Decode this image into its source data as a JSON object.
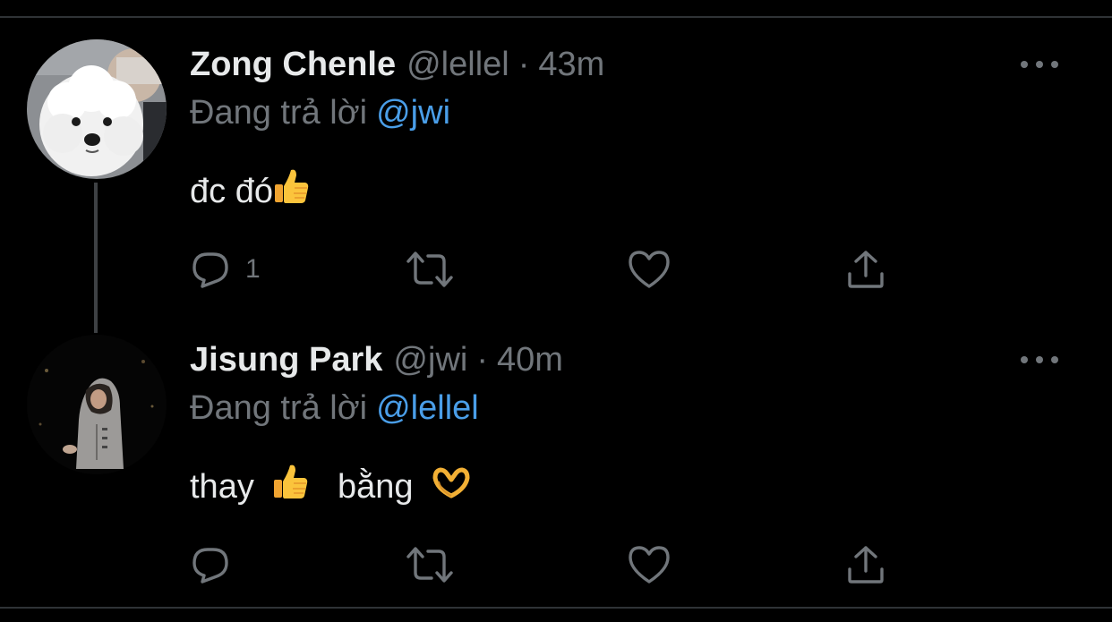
{
  "colors": {
    "background": "#000000",
    "divider": "#2f3336",
    "primary_text": "#e7e9ea",
    "secondary_text": "#71767b",
    "mention": "#4a9ee8"
  },
  "tweets": [
    {
      "display_name": "Zong Chenle",
      "handle": "@lellel",
      "separator": "·",
      "time": "43m",
      "reply_prefix": "Đang trả lời",
      "reply_to": "@jwi",
      "text": "đc đó",
      "text_emoji": "thumbs-up",
      "reply_count": "1",
      "icons": [
        "reply-icon",
        "retweet-icon",
        "like-icon",
        "share-icon",
        "more-icon"
      ]
    },
    {
      "display_name": "Jisung Park",
      "handle": "@jwi",
      "separator": "·",
      "time": "40m",
      "reply_prefix": "Đang trả lời",
      "reply_to": "@lellel",
      "text_part1": "thay",
      "text_emoji1": "thumbs-up",
      "text_part2": "bằng",
      "text_emoji2": "heart-hands",
      "icons": [
        "reply-icon",
        "retweet-icon",
        "like-icon",
        "share-icon",
        "more-icon"
      ]
    }
  ]
}
